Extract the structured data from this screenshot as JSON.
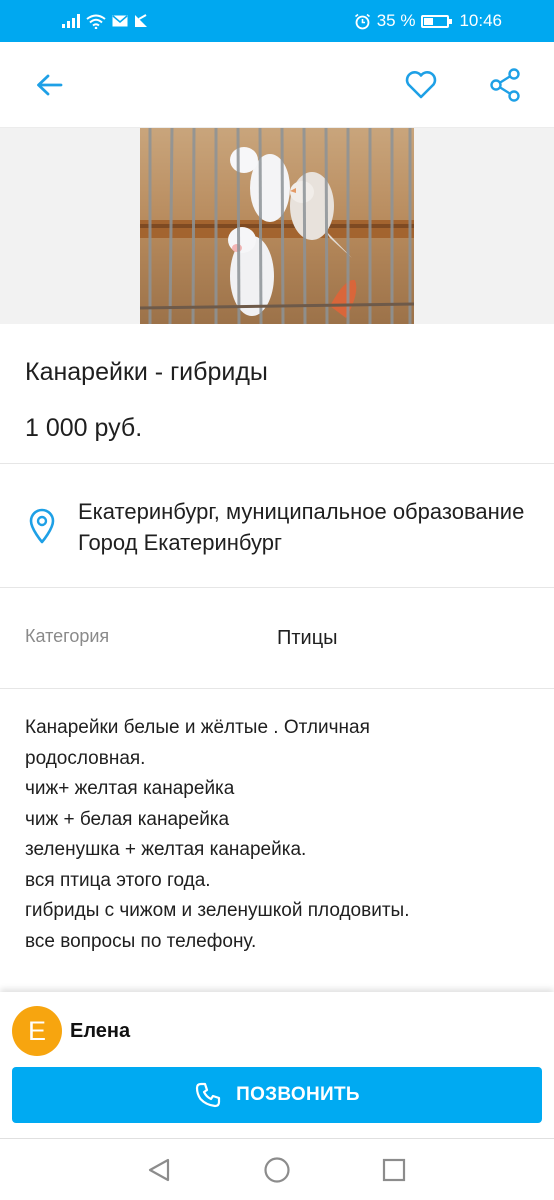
{
  "status_bar": {
    "battery_percent": "35 %",
    "time": "10:46",
    "battery_level": 0.35,
    "icons": [
      "signal-icon",
      "wifi-icon",
      "mail-icon",
      "notification-icon",
      "alarm-icon",
      "battery-icon"
    ]
  },
  "colors": {
    "accent": "#00a8f0",
    "button": "#00aaf2",
    "avatar": "#f7a50f"
  },
  "toolbar": {
    "icons": [
      "back-arrow-icon",
      "heart-icon",
      "share-icon"
    ]
  },
  "listing": {
    "title": "Канарейки - гибриды",
    "price": "1 000 руб.",
    "location": "Екатеринбург, муниципальное образование Город Екатеринбург",
    "category_label": "Категория",
    "category_value": "Птицы",
    "description": [
      "Канарейки белые и жёлтые . Отличная",
      "родословная.",
      "чиж+ желтая канарейка",
      "чиж + белая канарейка",
      "зеленушка + желтая канарейка.",
      "вся птица этого года.",
      "гибриды с чижом и зеленушкой плодовиты.",
      "все вопросы по телефону."
    ]
  },
  "seller": {
    "initial": "Е",
    "name": "Елена",
    "call_label": "ПОЗВОНИТЬ"
  },
  "navbar": {
    "icons": [
      "nav-back-icon",
      "nav-home-icon",
      "nav-recent-icon"
    ]
  }
}
